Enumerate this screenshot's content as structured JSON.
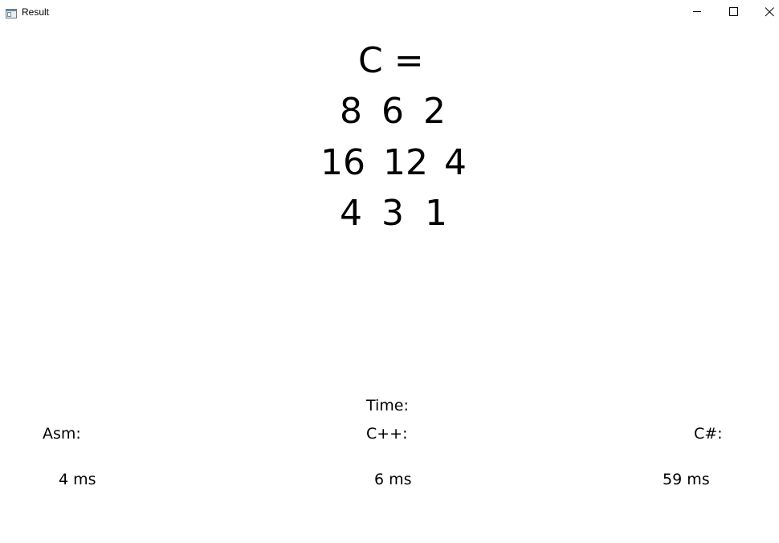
{
  "window": {
    "title": "Result",
    "icon": "app-window-icon"
  },
  "matrix": {
    "header": "C =",
    "rows": [
      [
        "8",
        "6",
        "2"
      ],
      [
        "16",
        "12",
        "4"
      ],
      [
        "4",
        "3",
        "1"
      ]
    ]
  },
  "timing": {
    "title": "Time:",
    "asm_label": "Asm:",
    "cpp_label": "C++:",
    "csharp_label": "C#:",
    "asm_value": "4 ms",
    "cpp_value": "6 ms",
    "csharp_value": "59 ms"
  }
}
